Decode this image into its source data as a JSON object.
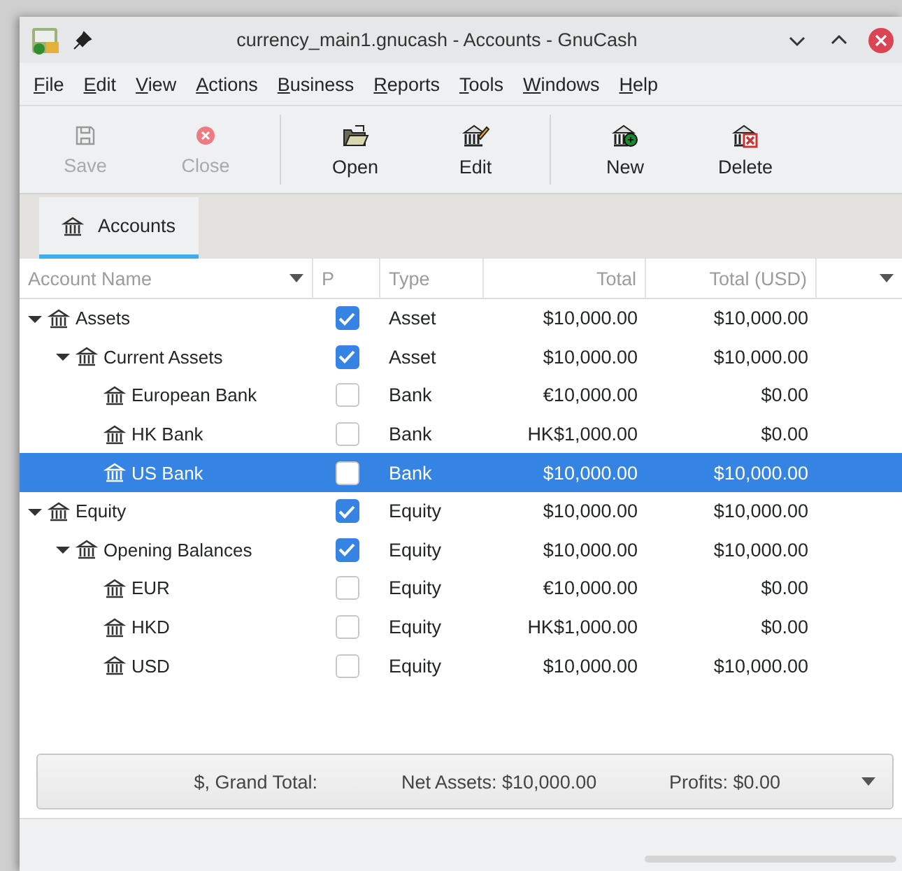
{
  "window": {
    "title": "currency_main1.gnucash - Accounts - GnuCash"
  },
  "menu": [
    "File",
    "Edit",
    "View",
    "Actions",
    "Business",
    "Reports",
    "Tools",
    "Windows",
    "Help"
  ],
  "toolbar": [
    {
      "label": "Save",
      "disabled": true
    },
    {
      "label": "Close",
      "disabled": true
    },
    {
      "label": "Open",
      "disabled": false
    },
    {
      "label": "Edit",
      "disabled": false
    },
    {
      "label": "New",
      "disabled": false
    },
    {
      "label": "Delete",
      "disabled": false
    }
  ],
  "tabs": [
    {
      "label": "Accounts",
      "selected": true
    }
  ],
  "table": {
    "columns": [
      "Account Name",
      "P",
      "Type",
      "Total",
      "Total (USD)"
    ],
    "rows": [
      {
        "name": "Assets",
        "placeholder": true,
        "type": "Asset",
        "total": "$10,000.00",
        "total_usd": "$10,000.00",
        "selected": false,
        "expanded": true,
        "children": [
          {
            "name": "Current Assets",
            "placeholder": true,
            "type": "Asset",
            "total": "$10,000.00",
            "total_usd": "$10,000.00",
            "selected": false,
            "expanded": true,
            "children": [
              {
                "name": "European Bank",
                "placeholder": false,
                "type": "Bank",
                "total": "€10,000.00",
                "total_usd": "$0.00",
                "selected": false
              },
              {
                "name": "HK Bank",
                "placeholder": false,
                "type": "Bank",
                "total": "HK$1,000.00",
                "total_usd": "$0.00",
                "selected": false
              },
              {
                "name": "US Bank",
                "placeholder": false,
                "type": "Bank",
                "total": "$10,000.00",
                "total_usd": "$10,000.00",
                "selected": true
              }
            ]
          }
        ]
      },
      {
        "name": "Equity",
        "placeholder": true,
        "type": "Equity",
        "total": "$10,000.00",
        "total_usd": "$10,000.00",
        "selected": false,
        "expanded": true,
        "children": [
          {
            "name": "Opening Balances",
            "placeholder": true,
            "type": "Equity",
            "total": "$10,000.00",
            "total_usd": "$10,000.00",
            "selected": false,
            "expanded": true,
            "children": [
              {
                "name": "EUR",
                "placeholder": false,
                "type": "Equity",
                "total": "€10,000.00",
                "total_usd": "$0.00",
                "selected": false
              },
              {
                "name": "HKD",
                "placeholder": false,
                "type": "Equity",
                "total": "HK$1,000.00",
                "total_usd": "$0.00",
                "selected": false
              },
              {
                "name": "USD",
                "placeholder": false,
                "type": "Equity",
                "total": "$10,000.00",
                "total_usd": "$10,000.00",
                "selected": false
              }
            ]
          }
        ]
      }
    ]
  },
  "summary": {
    "label": "$, Grand Total:",
    "net_assets": "Net Assets: $10,000.00",
    "profits": "Profits: $0.00"
  },
  "status_bar": {
    "progress": {
      "level": 0
    }
  }
}
